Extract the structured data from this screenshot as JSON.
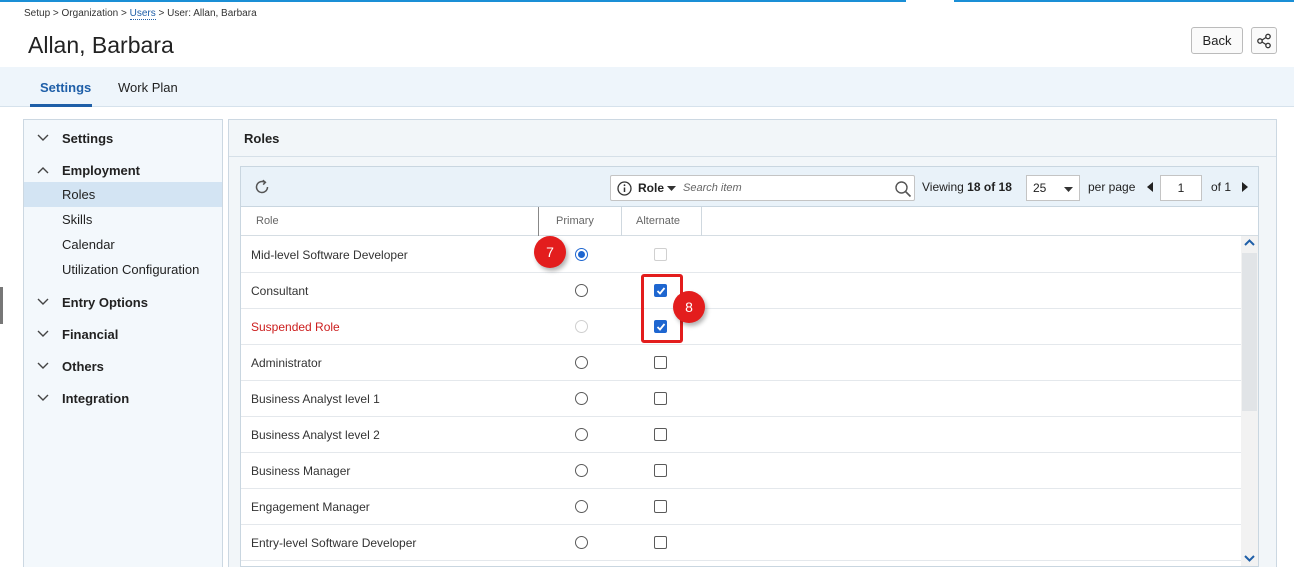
{
  "breadcrumb": {
    "part1": "Setup > Organization > ",
    "link": "Users",
    "part2": " > User: Allan, Barbara"
  },
  "page_title": "Allan, Barbara",
  "header_buttons": {
    "back": "Back",
    "share_icon": "share-icon"
  },
  "tabs": [
    {
      "label": "Settings",
      "active": true
    },
    {
      "label": "Work Plan",
      "active": false
    }
  ],
  "sidenav": {
    "groups": [
      {
        "label": "Settings",
        "expanded": false
      },
      {
        "label": "Employment",
        "expanded": true,
        "items": [
          "Roles",
          "Skills",
          "Calendar",
          "Utilization Configuration"
        ],
        "selected": "Roles"
      },
      {
        "label": "Entry Options",
        "expanded": false
      },
      {
        "label": "Financial",
        "expanded": false
      },
      {
        "label": "Others",
        "expanded": false
      },
      {
        "label": "Integration",
        "expanded": false
      }
    ]
  },
  "panel": {
    "title": "Roles"
  },
  "toolbar": {
    "search_field": "Role",
    "search_placeholder": "Search item",
    "viewing_label": "Viewing",
    "viewing_count": "18",
    "viewing_of": "of",
    "viewing_total": "18",
    "per_page_value": "25",
    "per_page_label": "per page",
    "page_value": "1",
    "page_of": "of 1"
  },
  "columns": {
    "role": "Role",
    "primary": "Primary",
    "alternate": "Alternate"
  },
  "rows": [
    {
      "role": "Mid-level Software Developer",
      "primary": "checked",
      "alternate": "disabled",
      "red": false
    },
    {
      "role": "Consultant",
      "primary": "unchecked",
      "alternate": "checked",
      "red": false
    },
    {
      "role": "Suspended Role",
      "primary": "disabled",
      "alternate": "checked",
      "red": true
    },
    {
      "role": "Administrator",
      "primary": "unchecked",
      "alternate": "unchecked",
      "red": false
    },
    {
      "role": "Business Analyst level 1",
      "primary": "unchecked",
      "alternate": "unchecked",
      "red": false
    },
    {
      "role": "Business Analyst level 2",
      "primary": "unchecked",
      "alternate": "unchecked",
      "red": false
    },
    {
      "role": "Business Manager",
      "primary": "unchecked",
      "alternate": "unchecked",
      "red": false
    },
    {
      "role": "Engagement Manager",
      "primary": "unchecked",
      "alternate": "unchecked",
      "red": false
    },
    {
      "role": "Entry-level Software Developer",
      "primary": "unchecked",
      "alternate": "unchecked",
      "red": false
    }
  ],
  "callouts": {
    "primary_step": "7",
    "alternate_step": "8"
  },
  "colors": {
    "accent": "#1f5fa8",
    "callout": "#e31d1d",
    "checkbox": "#1e66d0",
    "suspended_text": "#cc1d1d"
  }
}
